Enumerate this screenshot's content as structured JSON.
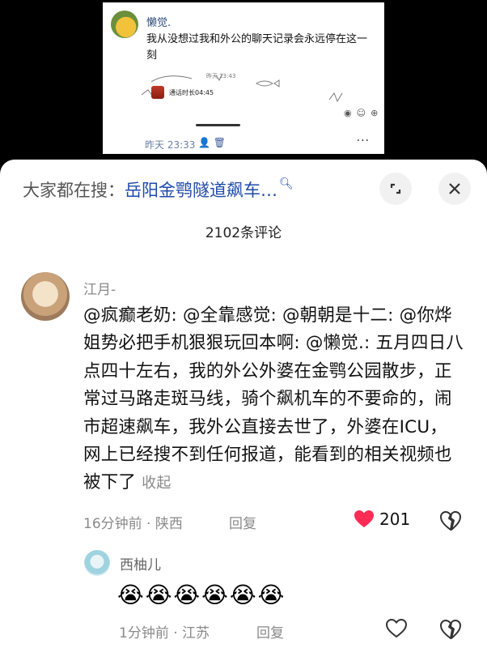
{
  "top_screenshot": {
    "sender_name": "懒觉.",
    "message": "我从没想过我和外公的聊天记录会永远停在这一刻",
    "call_label": "通话时长04:45",
    "small_time": "昨天 23:43",
    "timestamp": "昨天 23:33",
    "more_icon": "···"
  },
  "sheet": {
    "search_prefix": "大家都在搜：",
    "search_query": "岳阳金鹗隧道飙车…",
    "comment_count": "2102条评论"
  },
  "comments": [
    {
      "user": "江月-",
      "text": "@疯癫老奶: @全靠感觉: @朝朝是十二: @你烨姐势必把手机狠狠玩回本啊: @懒觉.: 五月四日八点四十左右，我的外公外婆在金鹗公园散步，正常过马路走斑马线，骑个飙机车的不要命的，闹市超速飙车，我外公直接去世了，外婆在ICU，网上已经搜不到任何报道，能看到的相关视频也被下了",
      "collapse": "收起",
      "meta": "16分钟前 · 陕西",
      "reply": "回复",
      "likes": "201",
      "liked": true
    },
    {
      "user": "西柚儿",
      "text": "😭😭😭😭😭😭",
      "meta": "1分钟前 · 江苏",
      "reply": "回复",
      "liked": false
    }
  ],
  "colors": {
    "link": "#1f4aa8",
    "like_active": "#fe2c55",
    "muted": "#8a8a8a"
  }
}
